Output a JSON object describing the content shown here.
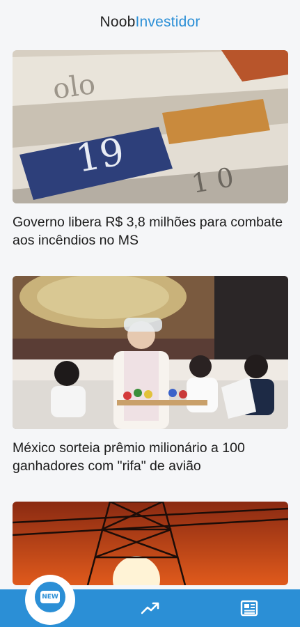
{
  "header": {
    "brand_part1": "Noob",
    "brand_part2": "Investidor"
  },
  "articles": [
    {
      "headline": "Governo libera R$ 3,8 milhões para combate aos incêndios no MS"
    },
    {
      "headline": "México sorteia prêmio milionário a 100 ganhadores com \"rifa\" de avião"
    },
    {
      "headline": ""
    }
  ],
  "bottom_nav": {
    "items": [
      {
        "icon": "new-icon",
        "label": "NEW",
        "active": true
      },
      {
        "icon": "trending-up-icon"
      },
      {
        "icon": "newspaper-icon"
      }
    ]
  },
  "colors": {
    "accent": "#2b8fd6",
    "background": "#f5f6f8"
  }
}
